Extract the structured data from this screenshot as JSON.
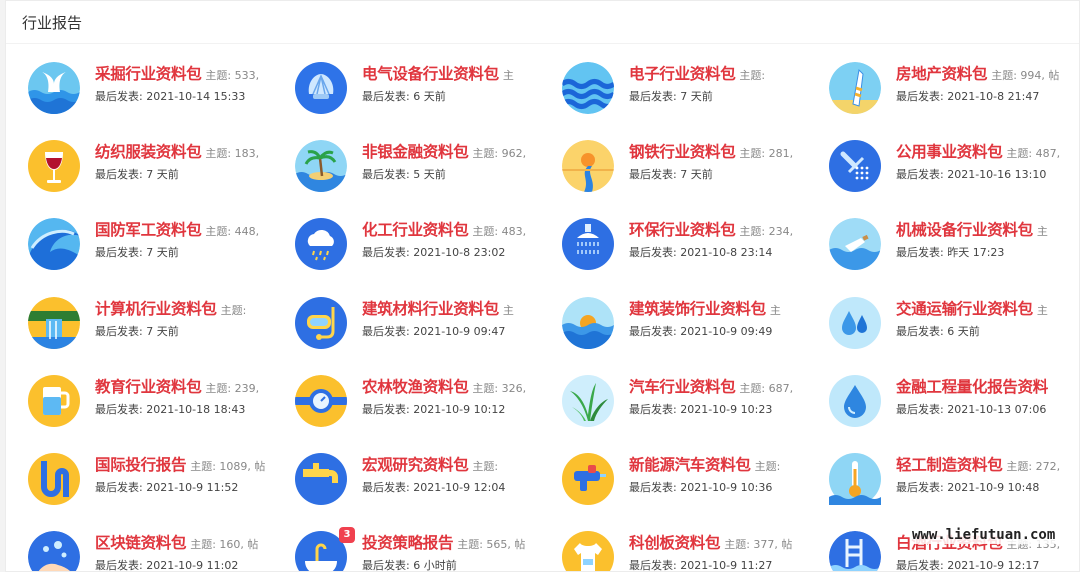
{
  "panel": {
    "title": "行业报告"
  },
  "watermark": "www.liefutuan.com",
  "forums": [
    {
      "name": "采掘行业资料包",
      "stats": "主题: 533,",
      "last": "最后发表: 2021-10-14 15:33",
      "icon": "whale-tail-icon",
      "badge": ""
    },
    {
      "name": "电气设备行业资料包",
      "stats": "主",
      "last": "最后发表: 6 天前",
      "icon": "shell-icon",
      "badge": ""
    },
    {
      "name": "电子行业资料包",
      "stats": "主题:",
      "last": "最后发表: 7 天前",
      "icon": "waves-icon",
      "badge": ""
    },
    {
      "name": "房地产资料包",
      "stats": "主题: 994, 帖",
      "last": "最后发表: 2021-10-8 21:47",
      "icon": "surfboard-icon",
      "badge": ""
    },
    {
      "name": "纺织服装资料包",
      "stats": "主题: 183,",
      "last": "最后发表: 7 天前",
      "icon": "wine-glass-icon",
      "badge": ""
    },
    {
      "name": "非银金融资料包",
      "stats": "主题: 962,",
      "last": "最后发表: 5 天前",
      "icon": "palm-island-icon",
      "badge": ""
    },
    {
      "name": "钢铁行业资料包",
      "stats": "主题: 281,",
      "last": "最后发表: 7 天前",
      "icon": "river-sunset-icon",
      "badge": ""
    },
    {
      "name": "公用事业资料包",
      "stats": "主题: 487,",
      "last": "最后发表: 2021-10-16 13:10",
      "icon": "shower-icon",
      "badge": ""
    },
    {
      "name": "国防军工资料包",
      "stats": "主题: 448,",
      "last": "最后发表: 7 天前",
      "icon": "big-wave-icon",
      "badge": ""
    },
    {
      "name": "化工行业资料包",
      "stats": "主题: 483,",
      "last": "最后发表: 2021-10-8 23:02",
      "icon": "rain-cloud-icon",
      "badge": ""
    },
    {
      "name": "环保行业资料包",
      "stats": "主题: 234,",
      "last": "最后发表: 2021-10-8 23:14",
      "icon": "shower-head-icon",
      "badge": ""
    },
    {
      "name": "机械设备行业资料包",
      "stats": "主",
      "last": "最后发表: 昨天 17:23",
      "icon": "bottle-sea-icon",
      "badge": ""
    },
    {
      "name": "计算机行业资料包",
      "stats": "主题:",
      "last": "最后发表: 7 天前",
      "icon": "waterfall-icon",
      "badge": ""
    },
    {
      "name": "建筑材料行业资料包",
      "stats": "主",
      "last": "最后发表: 2021-10-9 09:47",
      "icon": "diving-mask-icon",
      "badge": ""
    },
    {
      "name": "建筑装饰行业资料包",
      "stats": "主",
      "last": "最后发表: 2021-10-9 09:49",
      "icon": "sea-sunset-icon",
      "badge": ""
    },
    {
      "name": "交通运输行业资料包",
      "stats": "主",
      "last": "最后发表: 6 天前",
      "icon": "water-drops-icon",
      "badge": ""
    },
    {
      "name": "教育行业资料包",
      "stats": "主题: 239,",
      "last": "最后发表: 2021-10-18 18:43",
      "icon": "water-glass-icon",
      "badge": ""
    },
    {
      "name": "农林牧渔资料包",
      "stats": "主题: 326,",
      "last": "最后发表: 2021-10-9 10:12",
      "icon": "water-meter-icon",
      "badge": ""
    },
    {
      "name": "汽车行业资料包",
      "stats": "主题: 687,",
      "last": "最后发表: 2021-10-9 10:23",
      "icon": "aloe-plant-icon",
      "badge": ""
    },
    {
      "name": "金融工程量化报告资料",
      "stats": "",
      "last": "最后发表: 2021-10-13 07:06",
      "icon": "water-drop-icon",
      "badge": ""
    },
    {
      "name": "国际投行报告",
      "stats": "主题: 1089, 帖",
      "last": "最后发表: 2021-10-9 11:52",
      "icon": "pipe-icon",
      "badge": ""
    },
    {
      "name": "宏观研究资料包",
      "stats": "主题:",
      "last": "最后发表: 2021-10-9 12:04",
      "icon": "faucet-icon",
      "badge": ""
    },
    {
      "name": "新能源汽车资料包",
      "stats": "主题:",
      "last": "最后发表: 2021-10-9 10:36",
      "icon": "water-gun-icon",
      "badge": ""
    },
    {
      "name": "轻工制造资料包",
      "stats": "主题: 272,",
      "last": "最后发表: 2021-10-9 10:48",
      "icon": "thermometer-icon",
      "badge": ""
    },
    {
      "name": "区块链资料包",
      "stats": "主题: 160, 帖",
      "last": "最后发表: 2021-10-9 11:02",
      "icon": "hand-wash-icon",
      "badge": ""
    },
    {
      "name": "投资策略报告",
      "stats": "主题: 565, 帖",
      "last": "最后发表: 6 小时前",
      "icon": "sink-icon",
      "badge": "3"
    },
    {
      "name": "科创板资料包",
      "stats": "主题: 377, 帖",
      "last": "最后发表: 2021-10-9 11:27",
      "icon": "tshirt-icon",
      "badge": ""
    },
    {
      "name": "白酒行业资料包",
      "stats": "主题: 135,",
      "last": "最后发表: 2021-10-9 12:17",
      "icon": "pool-ladder-icon",
      "badge": ""
    }
  ]
}
